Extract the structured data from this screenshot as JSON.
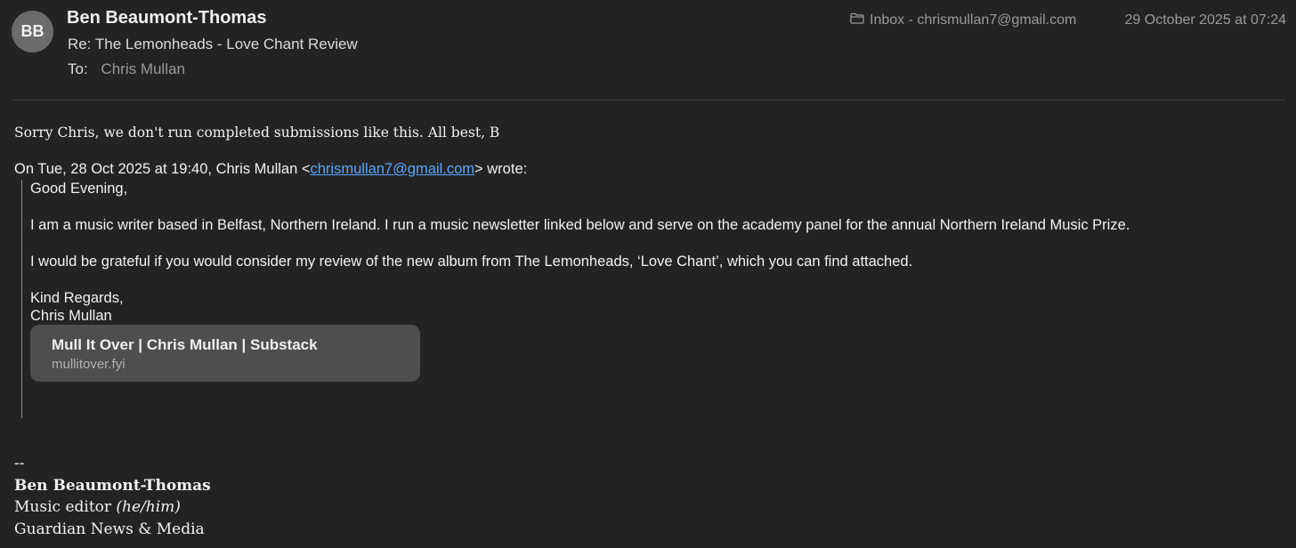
{
  "header": {
    "avatar_initials": "BB",
    "sender": "Ben Beaumont-Thomas",
    "subject": "Re: The Lemonheads - Love Chant Review",
    "to_label": "To:",
    "to_value": "Chris Mullan",
    "mailbox_icon": "folder-icon",
    "mailbox": "Inbox - chrismullan7@gmail.com",
    "date": "29 October 2025 at 07:24"
  },
  "body": {
    "reply": "Sorry Chris, we don't run completed submissions like this. All best, B",
    "attribution_prefix": "On Tue, 28 Oct 2025 at 19:40, Chris Mullan <",
    "attribution_email": "chrismullan7@gmail.com",
    "attribution_suffix": "> wrote:",
    "quoted": {
      "greeting": "Good Evening,",
      "para1": "I am a music writer based in Belfast, Northern Ireland. I run a music newsletter linked below and serve on the academy panel for the annual Northern Ireland Music Prize.",
      "para2": "I would be grateful if you would consider my review of the new album from The Lemonheads, ‘Love Chant’, which you can find attached.",
      "closing": "Kind Regards,",
      "closing_name": "Chris Mullan",
      "link_card": {
        "title": "Mull It Over | Chris Mullan | Substack",
        "url": "mullitover.fyi"
      }
    }
  },
  "signature": {
    "separator": "--",
    "name": "Ben Beaumont-Thomas",
    "role": "Music editor",
    "pronouns": "(he/him)",
    "organization": "Guardian News & Media"
  },
  "colors": {
    "background": "#232323",
    "link": "#5aa6ff",
    "card": "#4e4e4e"
  }
}
